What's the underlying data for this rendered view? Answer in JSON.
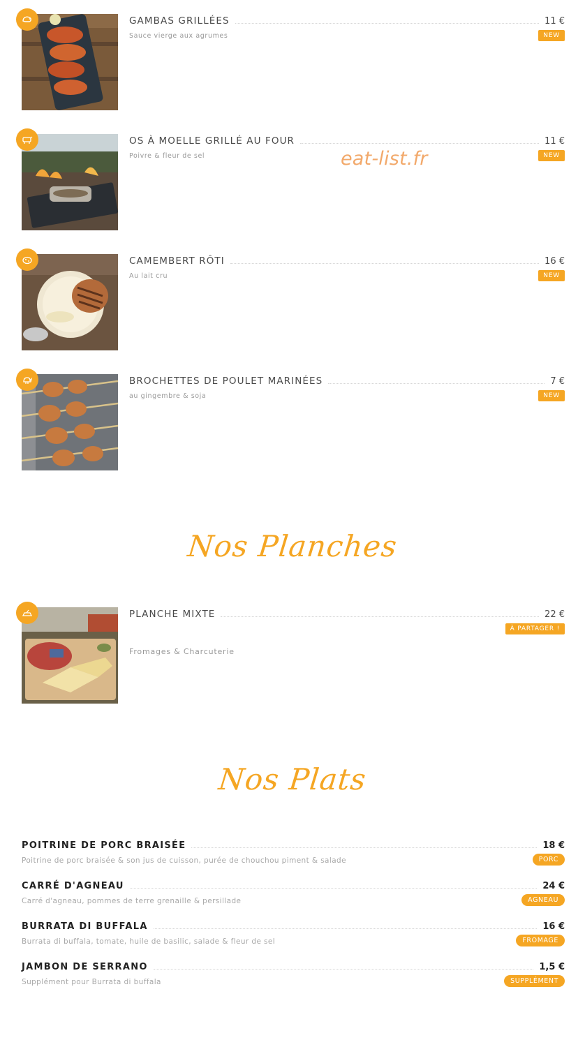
{
  "watermark": "eat-list.fr",
  "items": [
    {
      "title": "GAMBAS GRILLÉES",
      "price": "11 €",
      "desc": "Sauce vierge aux agrumes",
      "tag": "NEW",
      "icon": "shrimp-icon",
      "photo": "grilled-shrimp-photo"
    },
    {
      "title": "OS À MOELLE GRILLÉ AU FOUR",
      "price": "11 €",
      "desc": "Poivre & fleur de sel",
      "tag": "NEW",
      "icon": "cow-icon",
      "photo": "bone-marrow-photo"
    },
    {
      "title": "CAMEMBERT RÔTI",
      "price": "16 €",
      "desc": "Au lait cru",
      "tag": "NEW",
      "icon": "cheese-icon",
      "photo": "camembert-photo"
    },
    {
      "title": "BROCHETTES DE POULET MARINÉES",
      "price": "7 €",
      "desc": "au gingembre & soja",
      "tag": "NEW",
      "icon": "chicken-icon",
      "photo": "chicken-skewers-photo"
    }
  ],
  "sections": {
    "planches": "Nos Planches",
    "plats": "Nos Plats"
  },
  "planche": {
    "title": "PLANCHE MIXTE",
    "price": "22 €",
    "tag": "À PARTAGER !",
    "desc": "Fromages & Charcuterie",
    "icon": "board-icon",
    "photo": "charcuterie-board-photo"
  },
  "plats": [
    {
      "name": "POITRINE DE PORC BRAISÉE",
      "price": "18 €",
      "desc": "Poitrine de porc braisée & son jus de cuisson, purée de chouchou piment & salade",
      "tag": "PORC"
    },
    {
      "name": "CARRÉ D'AGNEAU",
      "price": "24 €",
      "desc": "Carré d'agneau, pommes de terre grenaille & persillade",
      "tag": "AGNEAU"
    },
    {
      "name": "BURRATA DI BUFFALA",
      "price": "16 €",
      "desc": "Burrata di buffala, tomate, huile de basilic, salade & fleur de sel",
      "tag": "FROMAGE"
    },
    {
      "name": "JAMBON DE SERRANO",
      "price": "1,5 €",
      "desc": "Supplément pour Burrata di buffala",
      "tag": "SUPPLÉMENT"
    }
  ],
  "colors": {
    "accent": "#f5a623",
    "text": "#3c3c3c",
    "muted": "#9a9a9a"
  }
}
